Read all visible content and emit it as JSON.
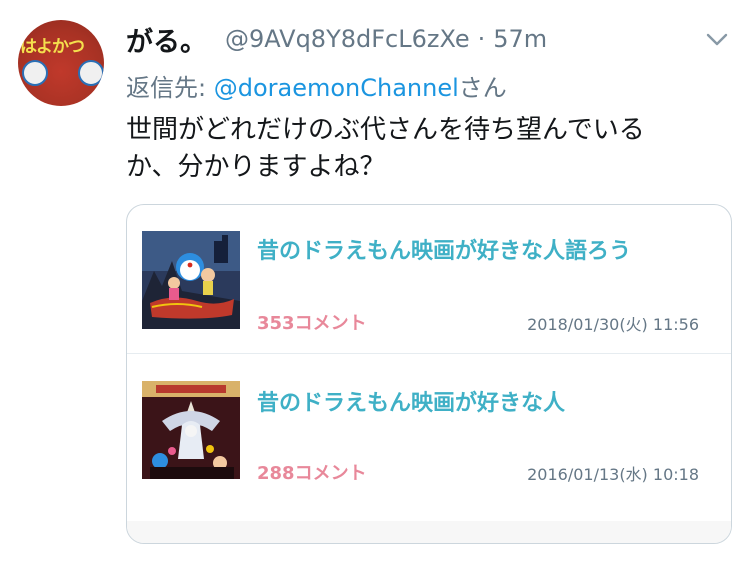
{
  "tweet": {
    "display_name": "がる。",
    "handle": "@9AVq8Y8dFcL6zXe",
    "separator": "·",
    "time": "57m",
    "reply_prefix": "返信先: ",
    "reply_mention": "@doraemonChannel",
    "reply_suffix": "さん",
    "text_lines": [
      "世間がどれだけのぶ代さんを待ち望んでいる",
      "か、分かりますよね？"
    ],
    "avatar_text": "はよかつ"
  },
  "card": {
    "threads": [
      {
        "title": "昔のドラえもん映画が好きな人語ろう",
        "comments": "353コメント",
        "date": "2018/01/30(火) 11:56"
      },
      {
        "title": "昔のドラえもん映画が好きな人",
        "comments": "288コメント",
        "date": "2016/01/13(水) 10:18"
      }
    ]
  },
  "colors": {
    "link": "#1b95e0",
    "thread_title": "#3fb0c6",
    "comment_count": "#e8889a",
    "muted": "#657786"
  }
}
